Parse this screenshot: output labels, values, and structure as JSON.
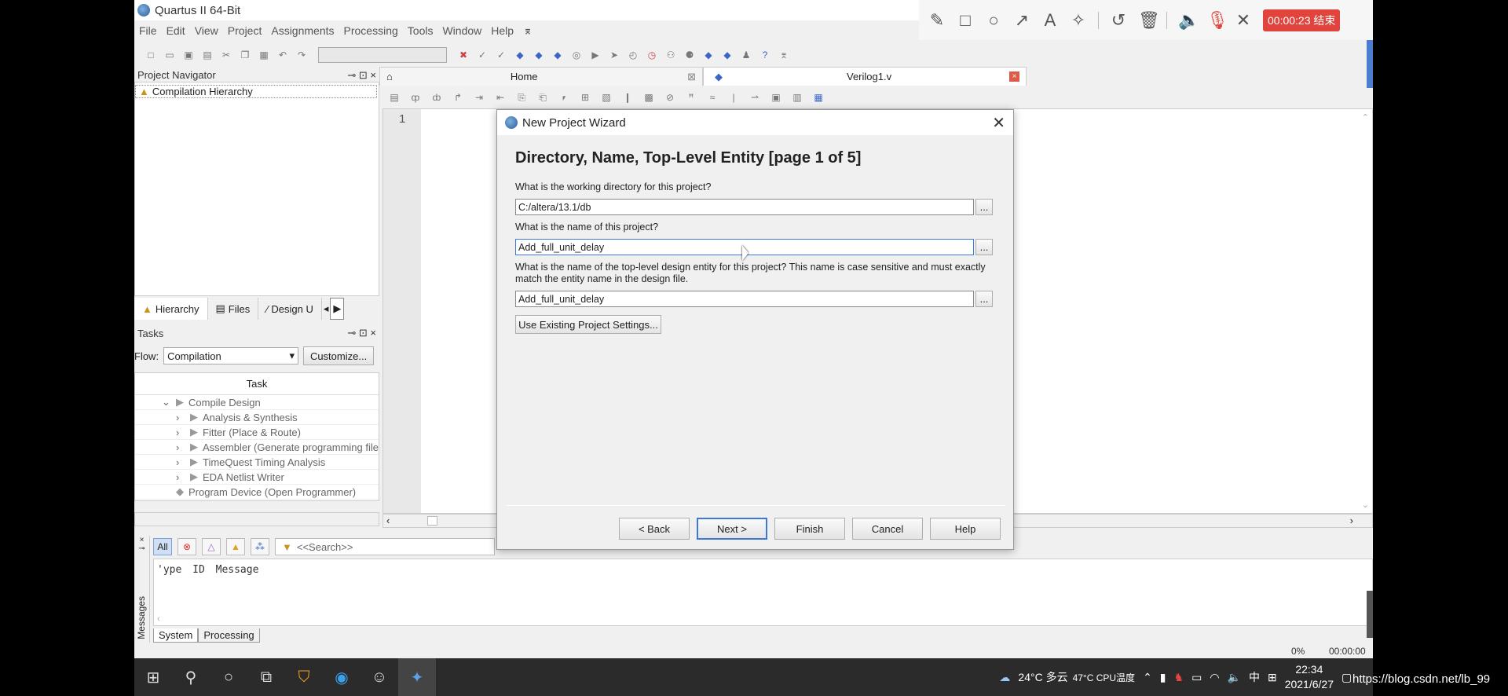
{
  "window": {
    "title": "Quartus II 64-Bit"
  },
  "menu": [
    "File",
    "Edit",
    "View",
    "Project",
    "Assignments",
    "Processing",
    "Tools",
    "Window",
    "Help"
  ],
  "recorder": {
    "timer": "00:00:23 结束"
  },
  "navigator": {
    "title": "Project Navigator",
    "item": "Compilation Hierarchy",
    "tabs": [
      "Hierarchy",
      "Files",
      "Design U"
    ]
  },
  "tasks": {
    "title": "Tasks",
    "flow_label": "Flow:",
    "flow_value": "Compilation",
    "customize": "Customize...",
    "column": "Task",
    "items": [
      "Compile Design",
      "Analysis & Synthesis",
      "Fitter (Place & Route)",
      "Assembler (Generate programming file",
      "TimeQuest Timing Analysis",
      "EDA Netlist Writer",
      "Program Device (Open Programmer)"
    ]
  },
  "editor": {
    "tabs": [
      "Home",
      "Verilog1.v"
    ],
    "line_number": "1"
  },
  "messages": {
    "all_label": "All",
    "search_placeholder": "<<Search>>",
    "columns": "'ype  ID  Message",
    "side_label": "Messages",
    "tabs": [
      "System",
      "Processing"
    ]
  },
  "status": {
    "percent": "0%",
    "time": "00:00:00"
  },
  "dialog": {
    "title": "New Project Wizard",
    "heading": "Directory, Name, Top-Level Entity [page 1 of 5]",
    "q1": "What is the working directory for this project?",
    "v1": "C:/altera/13.1/db",
    "q2": "What is the name of this project?",
    "v2": "Add_full_unit_delay",
    "q3": "What is the name of the top-level design entity for this project? This name is case sensitive and must exactly match the entity name in the design file.",
    "v3": "Add_full_unit_delay",
    "browse": "...",
    "use_existing": "Use Existing Project Settings...",
    "buttons": {
      "back": "< Back",
      "next": "Next >",
      "finish": "Finish",
      "cancel": "Cancel",
      "help": "Help"
    }
  },
  "taskbar": {
    "weather": "24°C 多云",
    "cpu": "47°C CPU温度",
    "ime": "中",
    "time": "22:34",
    "date": "2021/6/27",
    "watermark": "https://blog.csdn.net/lb_99"
  }
}
